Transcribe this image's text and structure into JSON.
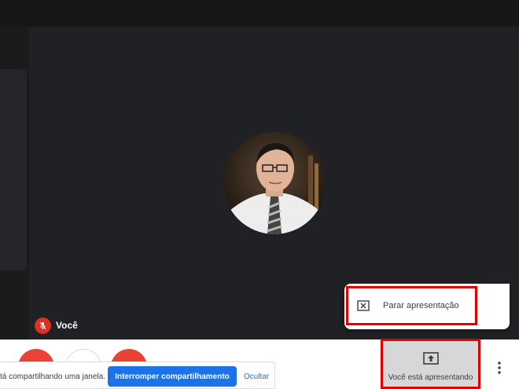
{
  "participant": {
    "name": "Você",
    "mic_muted": true
  },
  "presentation_menu": {
    "stop_label": "Parar apresentação"
  },
  "share_notice": {
    "text": "tá compartilhando uma janela.",
    "stop_button": "Interromper compartilhamento",
    "hide_link": "Ocultar"
  },
  "present_button": {
    "label": "Você está apresentando"
  },
  "colors": {
    "danger": "#ea4335",
    "primary": "#1a73e8",
    "highlight": "#e00000",
    "tile_bg": "#202124"
  },
  "icons": [
    "mic-off-icon",
    "close-box-icon",
    "present-to-all-icon",
    "more-vert-icon",
    "mic-icon",
    "call-end-icon",
    "videocam-icon"
  ]
}
